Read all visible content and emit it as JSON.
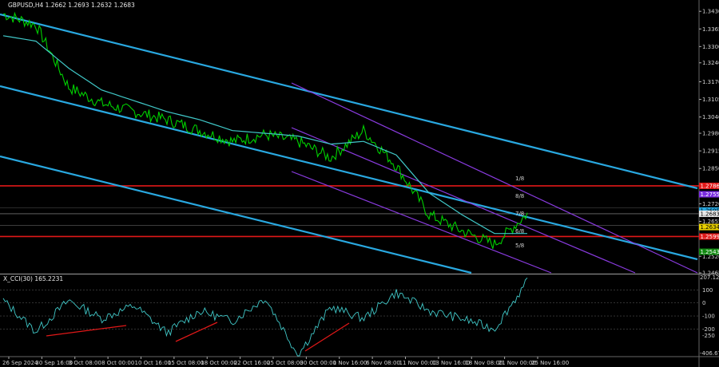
{
  "main_title": "GBPUSD,H4  1.2662 1.2693 1.2632 1.2683",
  "indicator_title": "X_CCI(30) 165.2231",
  "price_axis": {
    "ticks": [
      "1.3430",
      "1.3365",
      "1.3300",
      "1.3240",
      "1.3170",
      "1.3105",
      "1.3040",
      "1.2980",
      "1.2915",
      "1.2850",
      "1.2720",
      "1.2655",
      "1.2526",
      "1.2465"
    ],
    "current_price": "1.2683",
    "tags": [
      {
        "price": 1.2786,
        "text": "1.2786",
        "color": "#e01818",
        "text_color": "#ffffff"
      },
      {
        "price": 1.2755,
        "text": "1.2755",
        "color": "#7a2be0",
        "text_color": "#ffffff"
      },
      {
        "price": 1.2695,
        "text": "1.2695",
        "color": "#29a8e0",
        "text_color": "#000000"
      },
      {
        "price": 1.2683,
        "text": "1.2683",
        "color": "#e8e8e8",
        "text_color": "#000000"
      },
      {
        "price": 1.2634,
        "text": "1.2634",
        "color": "#e8d000",
        "text_color": "#000000"
      },
      {
        "price": 1.2599,
        "text": "1.2599",
        "color": "#e01818",
        "text_color": "#ffffff"
      },
      {
        "price": 1.2543,
        "text": "1.2543",
        "color": "#108a10",
        "text_color": "#ffffff"
      }
    ]
  },
  "cci_axis": {
    "top_value": "207.1249",
    "ticks": [
      "100",
      "0",
      "-100",
      "-200",
      "-250"
    ],
    "bottom_value": "-406.6774"
  },
  "time_axis": [
    "26 Sep 2024",
    "30 Sep 16:00",
    "3 Oct 08:00",
    "8 Oct 00:00",
    "10 Oct 16:00",
    "15 Oct 08:00",
    "18 Oct 00:00",
    "22 Oct 16:00",
    "25 Oct 08:00",
    "30 Oct 00:00",
    "1 Nov 16:00",
    "6 Nov 08:00",
    "11 Nov 00:00",
    "13 Nov 16:00",
    "18 Nov 08:00",
    "21 Nov 00:00",
    "25 Nov 16:00"
  ],
  "murray_labels": [
    "1/8",
    "8/8",
    "7/8",
    "6/8",
    "5/8"
  ],
  "colors": {
    "background": "#000000",
    "price_line": "#00d000",
    "moving_average": "#40c8c8",
    "channel": "#29a8e0",
    "purple_channel": "#8a3be0",
    "red_level": "#e01818",
    "cci_line": "#40c8c8",
    "divergence": "#e01818"
  },
  "chart_data": {
    "type": "line",
    "title": "GBPUSD,H4  1.2662 1.2693 1.2632 1.2683",
    "x": [
      "26 Sep 2024",
      "30 Sep 16:00",
      "3 Oct 08:00",
      "8 Oct 00:00",
      "10 Oct 16:00",
      "15 Oct 08:00",
      "18 Oct 00:00",
      "22 Oct 16:00",
      "25 Oct 08:00",
      "30 Oct 00:00",
      "1 Nov 16:00",
      "6 Nov 08:00",
      "11 Nov 00:00",
      "13 Nov 16:00",
      "18 Nov 08:00",
      "21 Nov 00:00",
      "25 Nov 16:00"
    ],
    "ylim": [
      1.2465,
      1.346
    ],
    "series": [
      {
        "values": [
          1.342,
          1.338,
          1.315,
          1.309,
          1.306,
          1.303,
          1.299,
          1.295,
          1.2975,
          1.295,
          1.289,
          1.299,
          1.286,
          1.268,
          1.262,
          1.257,
          1.2683
        ]
      },
      {
        "values": [
          1.334,
          1.332,
          1.322,
          1.314,
          1.31,
          1.306,
          1.303,
          1.299,
          1.298,
          1.297,
          1.294,
          1.295,
          1.29,
          1.276,
          1.268,
          1.261,
          1.261
        ]
      }
    ],
    "cci": {
      "ylim": [
        -406.6774,
        207.1249
      ],
      "values": [
        20,
        -220,
        20,
        -120,
        -20,
        -230,
        -60,
        -140,
        40,
        -400,
        -30,
        -120,
        80,
        -60,
        -120,
        -200,
        165
      ]
    }
  }
}
